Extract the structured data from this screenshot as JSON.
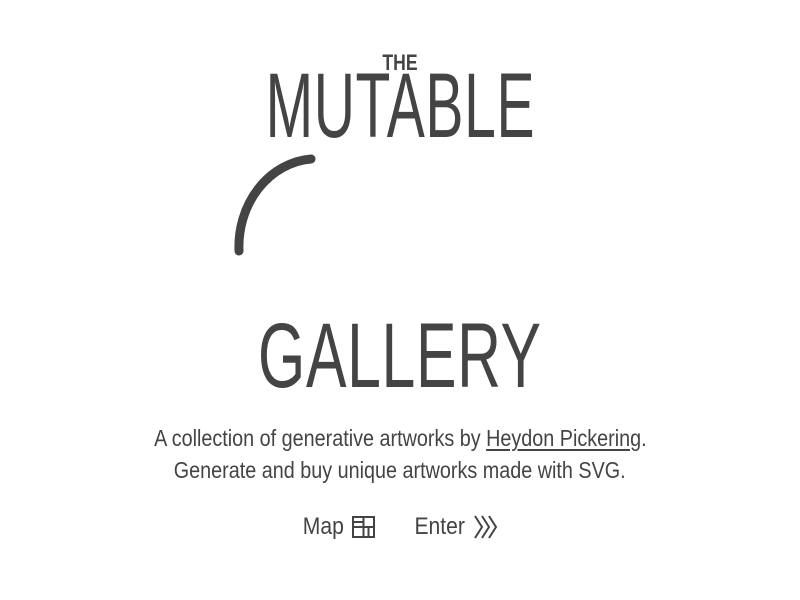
{
  "header": {
    "title_small": "THE",
    "title_main": "MUTABLE",
    "title_bottom": "GALLERY"
  },
  "description": {
    "line1_prefix": "A collection of generative artworks by ",
    "author_link": "Heydon Pickering",
    "line1_suffix": ".",
    "line2": "Generate and buy unique artworks made with SVG."
  },
  "nav": {
    "map_label": "Map",
    "map_icon": "map-grid-icon",
    "enter_label": "Enter",
    "enter_icon": "triple-chevron-right-icon"
  },
  "colors": {
    "text": "#444444",
    "background": "#ffffff"
  }
}
